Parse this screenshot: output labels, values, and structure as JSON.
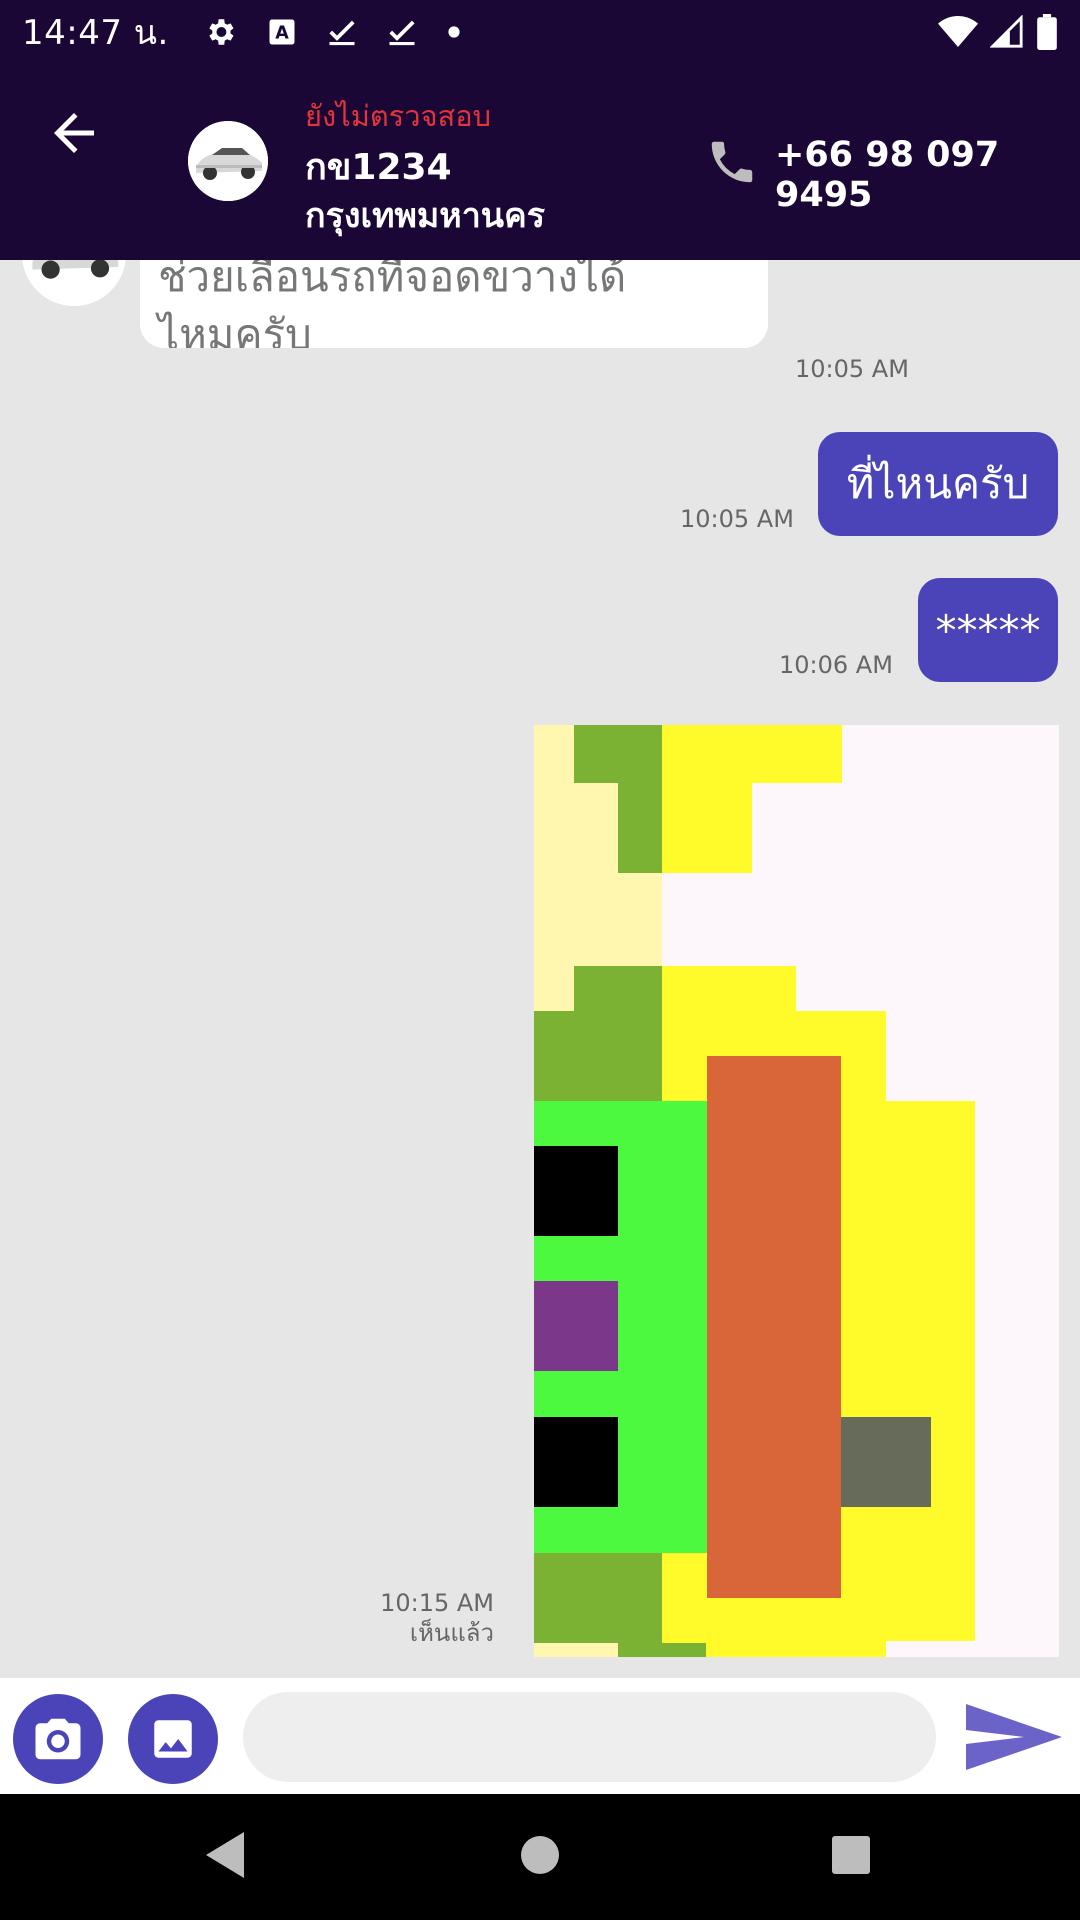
{
  "status_bar": {
    "time": "14:47 น.",
    "icons": [
      "settings-icon",
      "keyboard-a-icon",
      "check-icon",
      "check-icon",
      "dot-icon",
      "wifi-icon",
      "signal-icon",
      "battery-icon"
    ]
  },
  "header": {
    "verification_status": "ยังไม่ตรวจสอบ",
    "plate": "กข1234",
    "province": "กรุงเทพมหานคร",
    "phone": "+66 98 097 9495"
  },
  "messages": [
    {
      "direction": "in",
      "text_line1": "ช่วยเลื่อนรถที่จอดขวางได้",
      "text_line2": "ไหมครับ",
      "time": "10:05 AM"
    },
    {
      "direction": "out",
      "text": "ที่ไหนครับ",
      "time": "10:05 AM"
    },
    {
      "direction": "out",
      "text": "*****",
      "time": "10:06 AM"
    },
    {
      "direction": "out",
      "type": "image",
      "time": "10:15 AM",
      "status": "เห็นแล้ว"
    }
  ],
  "composer": {
    "placeholder": ""
  },
  "colors": {
    "header_bg": "#1a0736",
    "bubble_out": "#4a44b8",
    "chat_bg": "#e6e6e6",
    "unverified": "#e2343a"
  }
}
